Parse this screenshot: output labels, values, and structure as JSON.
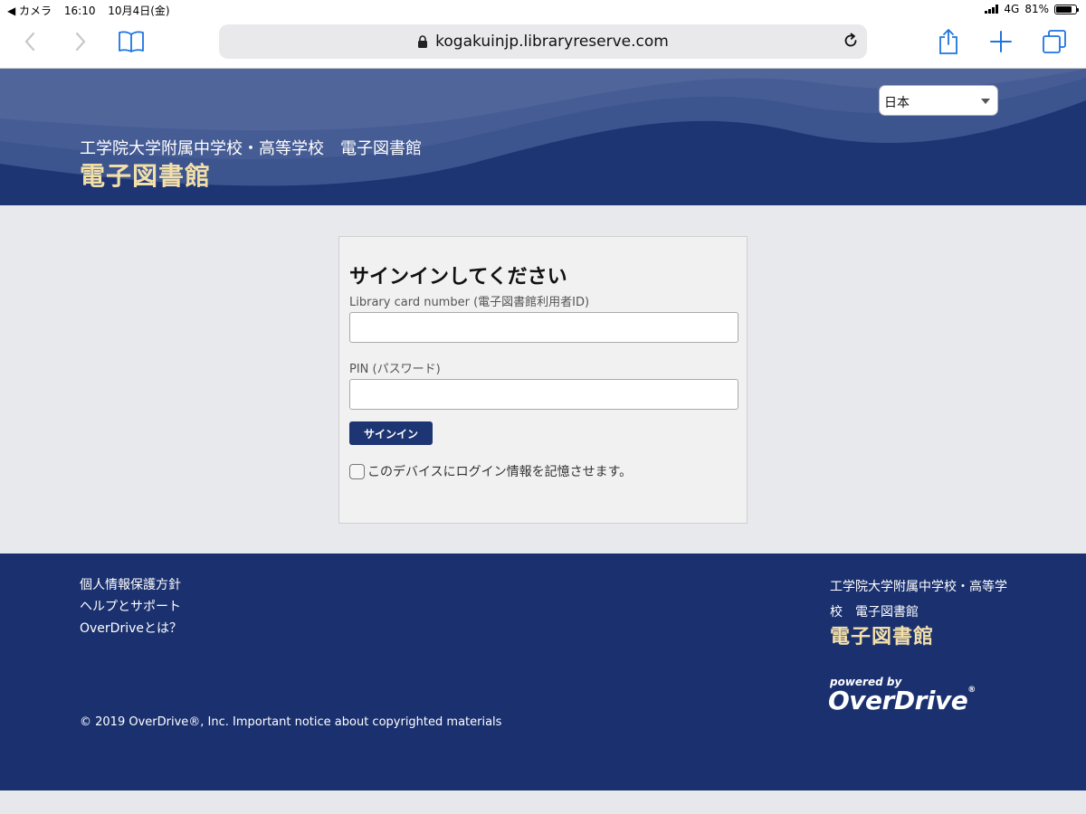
{
  "status_bar": {
    "back_app": "◀ カメラ",
    "time": "16:10",
    "date": "10月4日(金)",
    "network": "4G",
    "battery": "81%",
    "battery_level": 0.81
  },
  "browser": {
    "url": "kogakuinjp.libraryreserve.com",
    "icons": {
      "back": "chevron-left-icon",
      "forward": "chevron-right-icon",
      "bookmarks": "book-icon",
      "reload": "reload-icon",
      "share": "share-icon",
      "new_tab": "plus-icon",
      "tabs": "tabs-icon"
    }
  },
  "header": {
    "language": "日本",
    "subtitle": "工学院大学附属中学校・高等学校　電子図書館",
    "title": "電子図書館"
  },
  "signin": {
    "heading": "サインインしてください",
    "card_label": "Library card number (電子図書館利用者ID)",
    "card_value": "",
    "pin_label": "PIN (パスワード)",
    "pin_value": "",
    "button": "サインイン",
    "remember": "このデバイスにログイン情報を記憶させます。"
  },
  "footer": {
    "links": [
      "個人情報保護方針",
      "ヘルプとサポート",
      "OverDriveとは？"
    ],
    "copyright": "© 2019 OverDrive®, Inc. Important notice about copyrighted materials",
    "library_name": "工学院大学附属中学校・高等学校　電子図書館",
    "library_title": "電子図書館",
    "powered_by": "powered by",
    "brand": "OverDrive"
  },
  "colors": {
    "navy": "#1b316f",
    "gold": "#f3dfa8",
    "background": "#e6e8eb",
    "accent_blue": "#1d74e0"
  }
}
